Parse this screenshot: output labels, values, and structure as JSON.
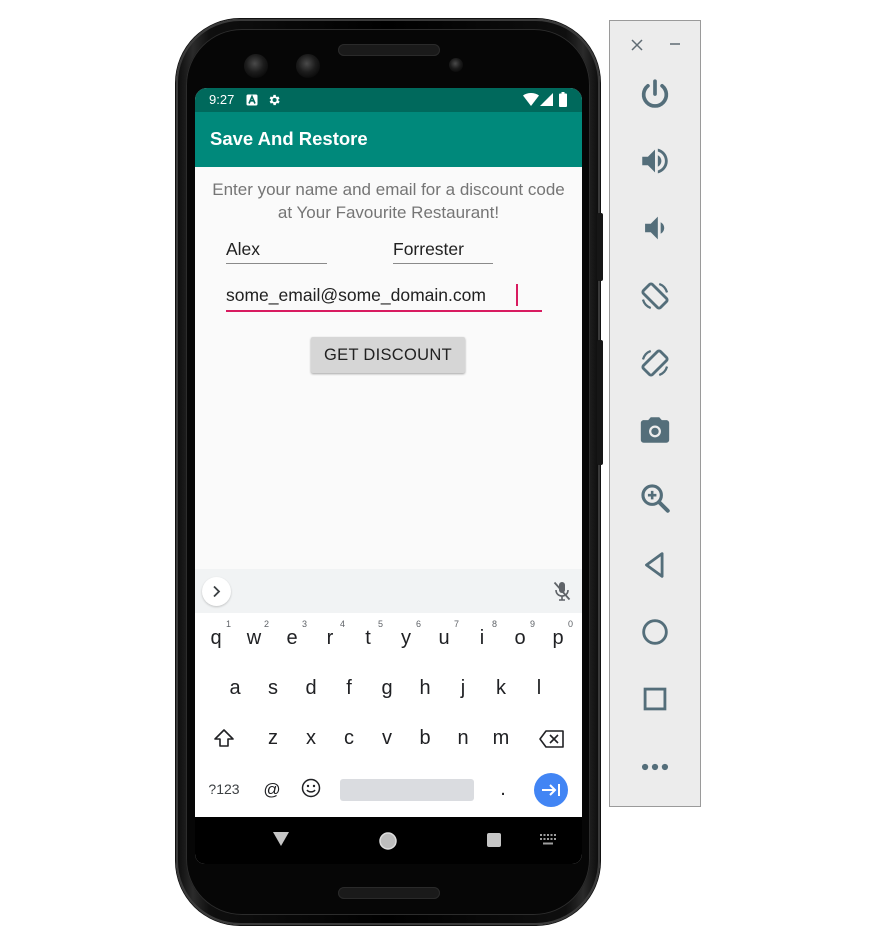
{
  "status_bar": {
    "time": "9:27"
  },
  "app_bar": {
    "title": "Save And Restore"
  },
  "form": {
    "prompt": "Enter your name and email for a discount code at Your Favourite Restaurant!",
    "first_name": "Alex",
    "last_name": "Forrester",
    "email": "some_email@some_domain.com",
    "button_label": "GET DISCOUNT"
  },
  "keyboard": {
    "row1": [
      {
        "key": "q",
        "hint": "1"
      },
      {
        "key": "w",
        "hint": "2"
      },
      {
        "key": "e",
        "hint": "3"
      },
      {
        "key": "r",
        "hint": "4"
      },
      {
        "key": "t",
        "hint": "5"
      },
      {
        "key": "y",
        "hint": "6"
      },
      {
        "key": "u",
        "hint": "7"
      },
      {
        "key": "i",
        "hint": "8"
      },
      {
        "key": "o",
        "hint": "9"
      },
      {
        "key": "p",
        "hint": "0"
      }
    ],
    "row2": [
      "a",
      "s",
      "d",
      "f",
      "g",
      "h",
      "j",
      "k",
      "l"
    ],
    "row3": [
      "z",
      "x",
      "c",
      "v",
      "b",
      "n",
      "m"
    ],
    "symbols_key": "?123",
    "at_key": "@",
    "period_key": "."
  },
  "colors": {
    "status_bar": "#00695c",
    "app_bar": "#00897b",
    "accent": "#d81b60",
    "keyboard_action": "#4285f4"
  },
  "side_panel": {
    "window_controls": [
      "close-icon",
      "minimize-icon"
    ],
    "tools": [
      "power-icon",
      "volume-up-icon",
      "volume-down-icon",
      "rotate-left-icon",
      "rotate-right-icon",
      "camera-icon",
      "zoom-icon",
      "back-icon",
      "home-icon",
      "overview-icon",
      "more-icon"
    ]
  }
}
